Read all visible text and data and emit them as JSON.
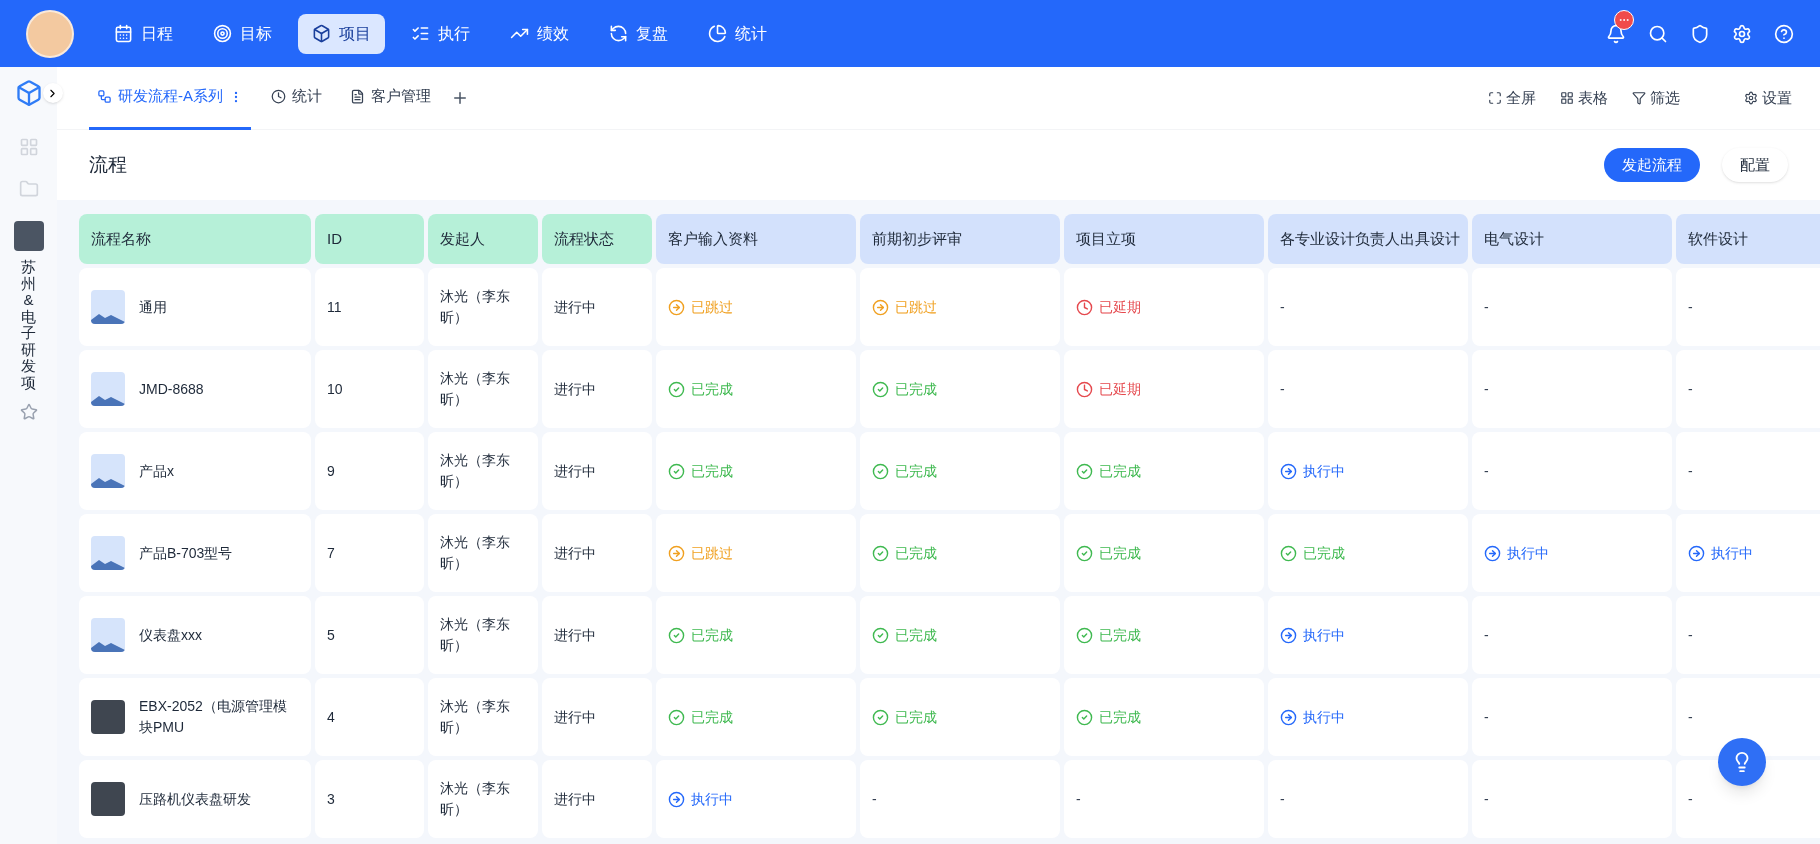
{
  "nav": [
    {
      "label": "日程",
      "selected": false
    },
    {
      "label": "目标",
      "selected": false
    },
    {
      "label": "项目",
      "selected": true
    },
    {
      "label": "执行",
      "selected": false
    },
    {
      "label": "绩效",
      "selected": false
    },
    {
      "label": "复盘",
      "selected": false
    },
    {
      "label": "统计",
      "selected": false
    }
  ],
  "sidebar": {
    "project_name": "苏州&电子研发项"
  },
  "tabs": [
    {
      "label": "研发流程-A系列",
      "selected": true
    },
    {
      "label": "统计",
      "selected": false
    },
    {
      "label": "客户管理",
      "selected": false
    }
  ],
  "toolbar": [
    "全屏",
    "表格",
    "筛选",
    "设置"
  ],
  "page_title": "流程",
  "buttons": [
    {
      "label": "发起流程",
      "kind": "primary"
    },
    {
      "label": "配置",
      "kind": "plain"
    }
  ],
  "table": {
    "columns": [
      {
        "label": "流程名称",
        "kind": "info"
      },
      {
        "label": "ID",
        "kind": "info"
      },
      {
        "label": "发起人",
        "kind": "info"
      },
      {
        "label": "流程状态",
        "kind": "info"
      },
      {
        "label": "客户输入资料",
        "kind": "stage"
      },
      {
        "label": "前期初步评审",
        "kind": "stage"
      },
      {
        "label": "项目立项",
        "kind": "stage"
      },
      {
        "label": "各专业设计负责人出具设计",
        "kind": "stage"
      },
      {
        "label": "电气设计",
        "kind": "stage"
      },
      {
        "label": "软件设计",
        "kind": "stage"
      }
    ],
    "rows": [
      {
        "name": "通用",
        "has_photo": false,
        "id": "11",
        "initiator": "沐光（李东昕）",
        "status": "进行中",
        "stages": [
          {
            "kind": "skipped",
            "text": "已跳过"
          },
          {
            "kind": "skipped",
            "text": "已跳过"
          },
          {
            "kind": "delayed",
            "text": "已延期"
          },
          {
            "kind": "none",
            "text": "-"
          },
          {
            "kind": "none",
            "text": "-"
          },
          {
            "kind": "none",
            "text": "-"
          }
        ]
      },
      {
        "name": "JMD-8688",
        "has_photo": false,
        "id": "10",
        "initiator": "沐光（李东昕）",
        "status": "进行中",
        "stages": [
          {
            "kind": "done",
            "text": "已完成"
          },
          {
            "kind": "done",
            "text": "已完成"
          },
          {
            "kind": "delayed",
            "text": "已延期"
          },
          {
            "kind": "none",
            "text": "-"
          },
          {
            "kind": "none",
            "text": "-"
          },
          {
            "kind": "none",
            "text": "-"
          }
        ]
      },
      {
        "name": "产品x",
        "has_photo": false,
        "id": "9",
        "initiator": "沐光（李东昕）",
        "status": "进行中",
        "stages": [
          {
            "kind": "done",
            "text": "已完成"
          },
          {
            "kind": "done",
            "text": "已完成"
          },
          {
            "kind": "done",
            "text": "已完成"
          },
          {
            "kind": "running",
            "text": "执行中"
          },
          {
            "kind": "none",
            "text": "-"
          },
          {
            "kind": "none",
            "text": "-"
          }
        ]
      },
      {
        "name": "产品B-703型号",
        "has_photo": false,
        "id": "7",
        "initiator": "沐光（李东昕）",
        "status": "进行中",
        "stages": [
          {
            "kind": "skipped",
            "text": "已跳过"
          },
          {
            "kind": "done",
            "text": "已完成"
          },
          {
            "kind": "done",
            "text": "已完成"
          },
          {
            "kind": "done",
            "text": "已完成"
          },
          {
            "kind": "running",
            "text": "执行中"
          },
          {
            "kind": "running",
            "text": "执行中"
          }
        ]
      },
      {
        "name": "仪表盘xxx",
        "has_photo": false,
        "id": "5",
        "initiator": "沐光（李东昕）",
        "status": "进行中",
        "stages": [
          {
            "kind": "done",
            "text": "已完成"
          },
          {
            "kind": "done",
            "text": "已完成"
          },
          {
            "kind": "done",
            "text": "已完成"
          },
          {
            "kind": "running",
            "text": "执行中"
          },
          {
            "kind": "none",
            "text": "-"
          },
          {
            "kind": "none",
            "text": "-"
          }
        ]
      },
      {
        "name": "EBX-2052（电源管理模块PMU",
        "has_photo": true,
        "id": "4",
        "initiator": "沐光（李东昕）",
        "status": "进行中",
        "stages": [
          {
            "kind": "done",
            "text": "已完成"
          },
          {
            "kind": "done",
            "text": "已完成"
          },
          {
            "kind": "done",
            "text": "已完成"
          },
          {
            "kind": "running",
            "text": "执行中"
          },
          {
            "kind": "none",
            "text": "-"
          },
          {
            "kind": "none",
            "text": "-"
          }
        ]
      },
      {
        "name": "压路机仪表盘研发",
        "has_photo": true,
        "id": "3",
        "initiator": "沐光（李东昕）",
        "status": "进行中",
        "stages": [
          {
            "kind": "running",
            "text": "执行中"
          },
          {
            "kind": "none",
            "text": "-"
          },
          {
            "kind": "none",
            "text": "-"
          },
          {
            "kind": "none",
            "text": "-"
          },
          {
            "kind": "none",
            "text": "-"
          },
          {
            "kind": "none",
            "text": "-"
          }
        ]
      }
    ]
  }
}
